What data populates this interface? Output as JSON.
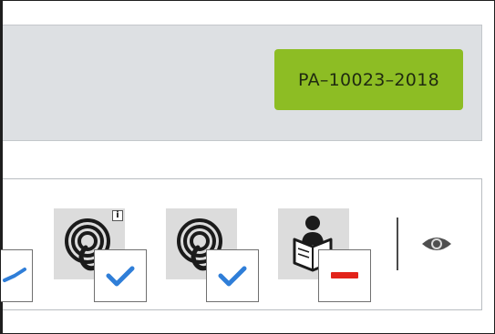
{
  "header": {
    "record_id": "PA–10023–2018",
    "badge_color": "#8dbd24"
  },
  "toolbar": {
    "items": [
      {
        "icon": "check-icon",
        "status": "checked"
      },
      {
        "icon": "hearing-aid-icon",
        "status": "checked",
        "has_info": true,
        "info_label": "i"
      },
      {
        "icon": "hearing-aid-icon",
        "status": "checked",
        "has_info": false
      },
      {
        "icon": "person-reading-icon",
        "status": "not-applicable"
      },
      {
        "icon": "eye-icon"
      }
    ],
    "colors": {
      "check": "#2f7ed8",
      "minus": "#e2231a"
    }
  }
}
